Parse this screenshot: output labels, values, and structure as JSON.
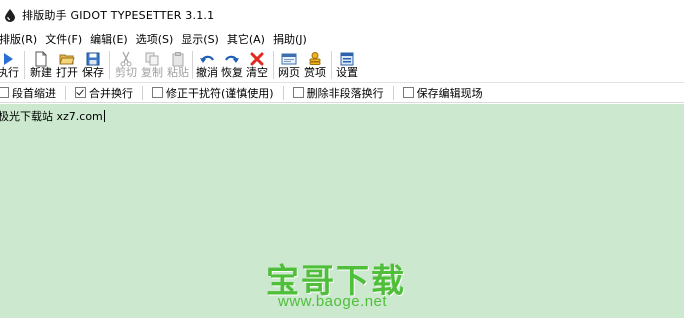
{
  "window": {
    "title": "排版助手 GIDOT TYPESETTER 3.1.1",
    "icon": "ink-drop-icon"
  },
  "menu": [
    "排版(R)",
    "文件(F)",
    "编辑(E)",
    "选项(S)",
    "显示(S)",
    "其它(A)",
    "捐助(J)"
  ],
  "toolbar": {
    "run": "执行",
    "new": "新建",
    "open": "打开",
    "save": "保存",
    "cut": "剪切",
    "copy": "复制",
    "paste": "粘贴",
    "undo": "撤消",
    "redo": "恢复",
    "clear": "清空",
    "web": "网页",
    "donate": "赏项",
    "settings": "设置"
  },
  "options": [
    {
      "label": "段首缩进",
      "checked": false
    },
    {
      "label": "合并换行",
      "checked": true
    },
    {
      "label": "修正干扰符(谨慎使用)",
      "checked": false
    },
    {
      "label": "删除非段落换行",
      "checked": false
    },
    {
      "label": "保存编辑现场",
      "checked": false
    }
  ],
  "editor": {
    "content": "极光下载站 xz7.com",
    "background": "#cce8cf"
  },
  "watermark": {
    "title": "宝哥下载",
    "url": "www.baoge.net",
    "color": "#4fbf3a"
  }
}
